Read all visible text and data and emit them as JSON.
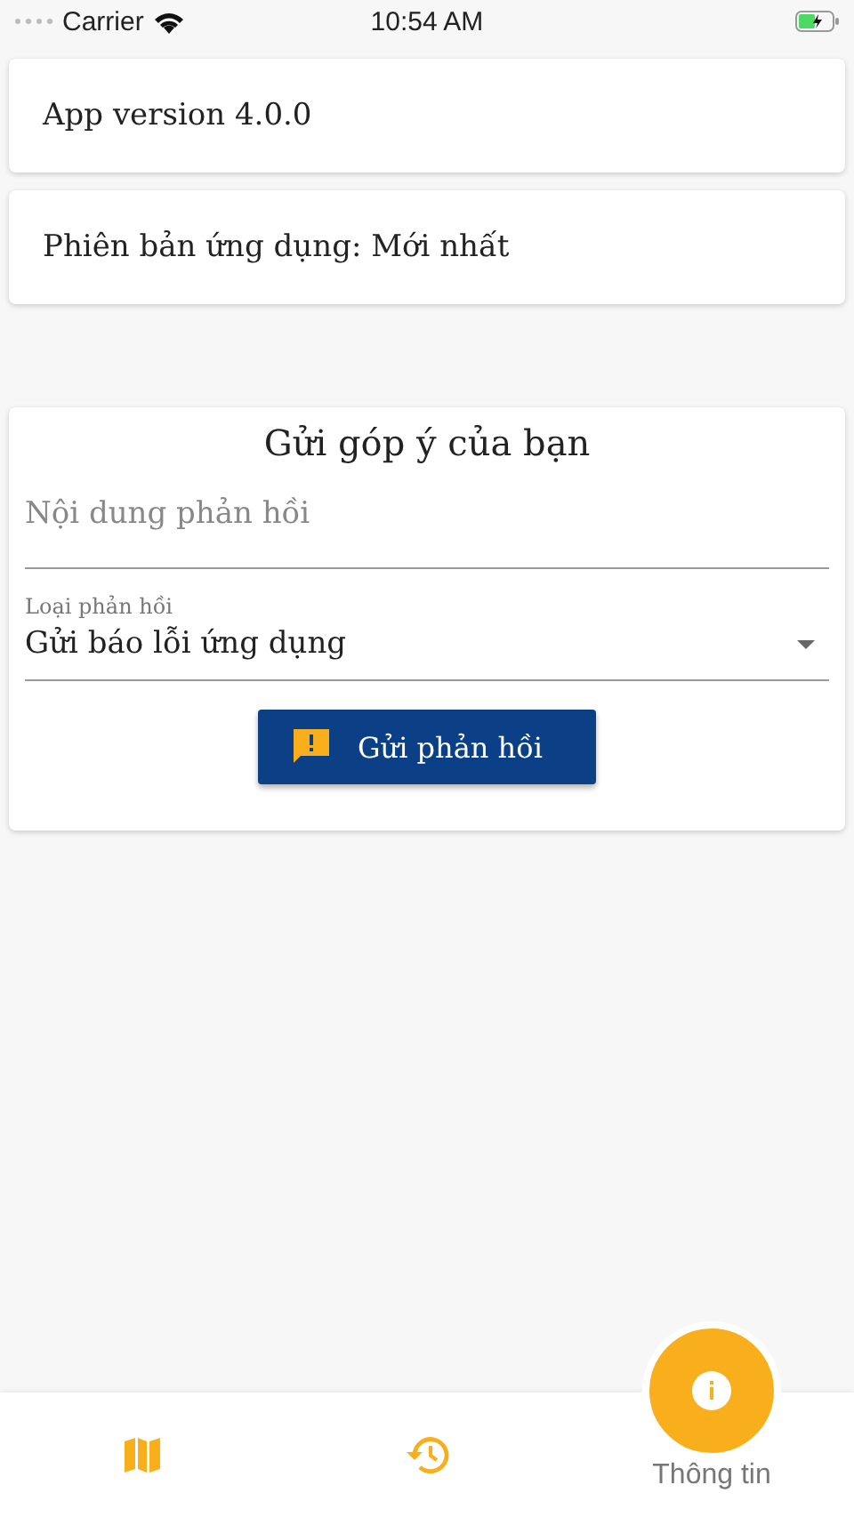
{
  "status_bar": {
    "carrier": "Carrier",
    "time": "10:54 AM"
  },
  "info_cards": [
    "App version 4.0.0",
    "Phiên bản ứng dụng: Mới nhất"
  ],
  "feedback": {
    "title": "Gửi góp ý của bạn",
    "content_field": {
      "placeholder": "Nội dung phản hồi"
    },
    "type_field": {
      "label": "Loại phản hồi",
      "value": "Gửi báo lỗi ứng dụng"
    },
    "submit": "Gửi phản hồi"
  },
  "tabs": [
    {
      "kind": "map",
      "selected": false
    },
    {
      "kind": "history",
      "selected": false
    },
    {
      "kind": "info",
      "selected": true,
      "label": "Thông tin"
    }
  ]
}
